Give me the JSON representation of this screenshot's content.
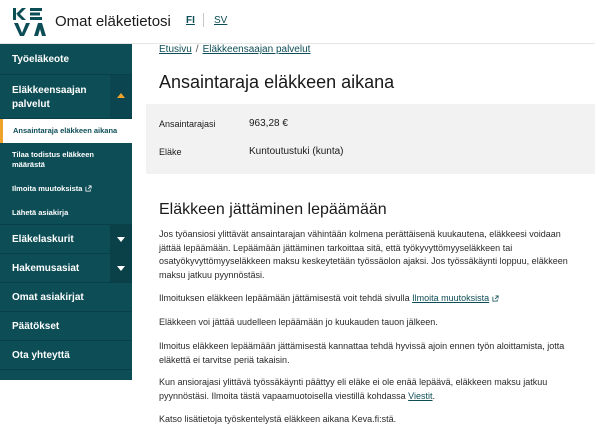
{
  "header": {
    "app_title": "Omat eläketietosi",
    "lang_fi": "FI",
    "lang_sv": "SV"
  },
  "sidebar": {
    "items": [
      {
        "label": "Työeläkeote"
      },
      {
        "label": "Eläkkeensaajan palvelut",
        "expanded": true
      },
      {
        "label": "Ansaintaraja eläkkeen aikana",
        "active": true
      },
      {
        "label": "Tilaa todistus eläkkeen määrästä"
      },
      {
        "label": "Ilmoita muutoksista",
        "external": true
      },
      {
        "label": "Lähetä asiakirja"
      },
      {
        "label": "Eläkelaskurit"
      },
      {
        "label": "Hakemusasiat"
      },
      {
        "label": "Omat asiakirjat"
      },
      {
        "label": "Päätökset"
      },
      {
        "label": "Ota yhteyttä"
      }
    ]
  },
  "breadcrumb": {
    "home": "Etusivu",
    "separator": "/",
    "current": "Eläkkeensaajan palvelut"
  },
  "page_title": "Ansaintaraja eläkkeen aikana",
  "info": {
    "limit_label": "Ansaintarajasi",
    "limit_value": "963,28 €",
    "pension_label": "Eläke",
    "pension_value": "Kuntoutustuki (kunta)"
  },
  "section": {
    "title": "Eläkkeen jättäminen lepäämään",
    "p1": "Jos työansiosi ylittävät ansaintarajan vähintään kolmena perättäisenä kuukautena, eläkkeesi voidaan jättää lepäämään. Lepäämään jättäminen tarkoittaa sitä, että työkyvyttömyyseläkkeen tai osatyökyvyttömyyseläkkeen maksu keskeytetään työssäolon ajaksi. Jos työssäkäynti loppuu, eläkkeen maksu jatkuu pyynnöstäsi.",
    "p2_text": "Ilmoituksen eläkkeen lepäämään jättämisestä voit tehdä sivulla",
    "p2_link": "Ilmoita muutoksista",
    "p3": "Eläkkeen voi jättää uudelleen lepäämään jo kuukauden tauon jälkeen.",
    "p4": "Ilmoitus eläkkeen lepäämään jättämisestä kannattaa tehdä hyvissä ajoin ennen työn aloittamista, jotta eläkettä ei tarvitse periä takaisin.",
    "p5_text": "Kun ansiorajasi ylittävä työssäkäynti päättyy eli eläke ei ole enää lepäävä, eläkkeen maksu jatkuu pyynnöstäsi. Ilmoita tästä vapaamuotoisella viestillä kohdassa",
    "p5_link": "Viestit",
    "p5_end": ".",
    "p6": "Katso lisätietoja työskentelystä eläkkeen aikana Keva.fi:stä."
  },
  "colors": {
    "sidebar_bg": "#0d4d56",
    "accent": "#f0a32b",
    "link": "#0d4d56"
  }
}
